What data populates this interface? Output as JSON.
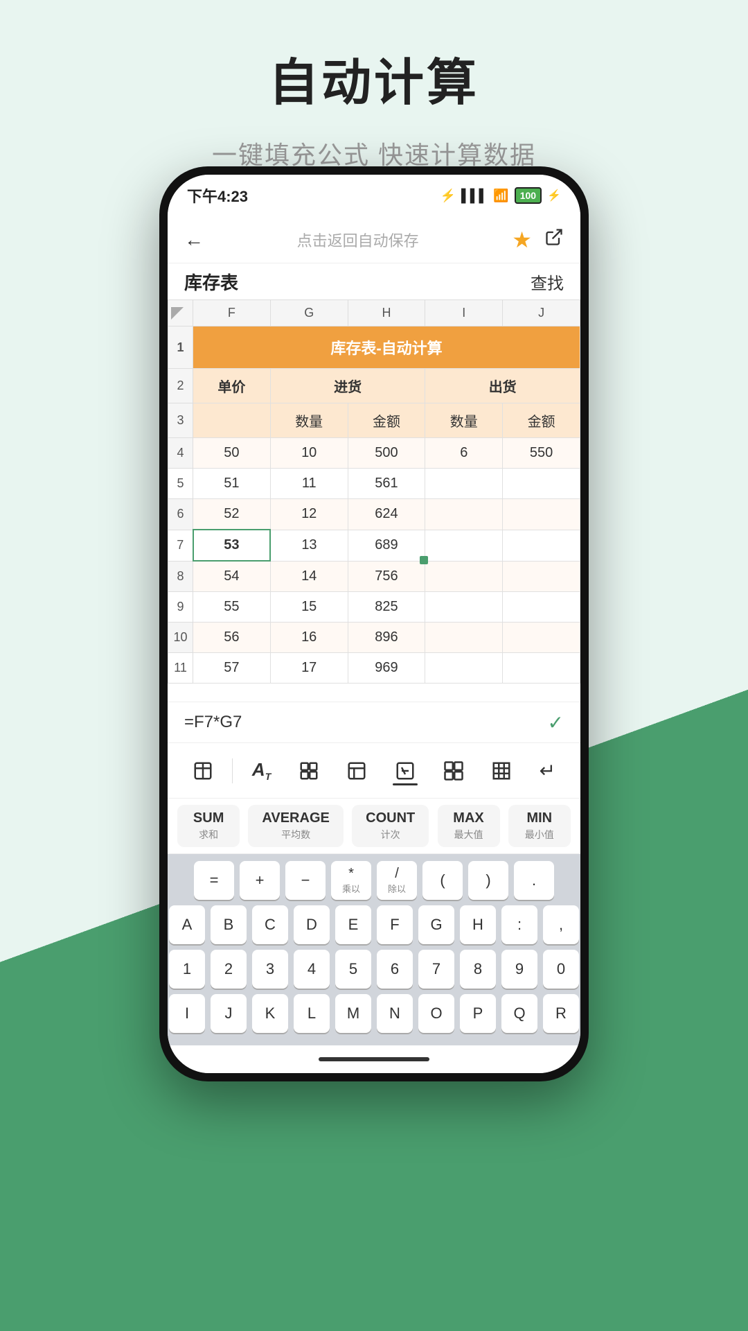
{
  "page": {
    "title": "自动计算",
    "subtitle": "一键填充公式 快速计算数据"
  },
  "status_bar": {
    "time": "下午4:23",
    "battery": "100"
  },
  "nav": {
    "back_label": "←",
    "center_label": "点击返回自动保存"
  },
  "sheet": {
    "name": "库存表",
    "find": "查找",
    "title": "库存表-自动计算",
    "col_headers": [
      "",
      "F",
      "G",
      "H",
      "I",
      "J"
    ],
    "row2": [
      "单价",
      "进货",
      "",
      "出货",
      ""
    ],
    "row3": [
      "",
      "数量",
      "金额",
      "数量",
      "金额"
    ],
    "rows": [
      {
        "num": "4",
        "f": "50",
        "g": "10",
        "h": "500",
        "i": "6",
        "j": "550"
      },
      {
        "num": "5",
        "f": "51",
        "g": "11",
        "h": "561",
        "i": "",
        "j": ""
      },
      {
        "num": "6",
        "f": "52",
        "g": "12",
        "h": "624",
        "i": "",
        "j": ""
      },
      {
        "num": "7",
        "f": "53",
        "g": "13",
        "h": "689",
        "i": "",
        "j": "",
        "selected": true
      },
      {
        "num": "8",
        "f": "54",
        "g": "14",
        "h": "756",
        "i": "",
        "j": ""
      },
      {
        "num": "9",
        "f": "55",
        "g": "15",
        "h": "825",
        "i": "",
        "j": ""
      },
      {
        "num": "10",
        "f": "56",
        "g": "16",
        "h": "896",
        "i": "",
        "j": ""
      },
      {
        "num": "11",
        "f": "57",
        "g": "17",
        "h": "969",
        "i": "",
        "j": ""
      }
    ]
  },
  "formula_bar": {
    "formula": "=F7*G7"
  },
  "toolbar": {
    "items": [
      {
        "icon": "⊟",
        "name": "table-settings"
      },
      {
        "icon": "A",
        "name": "text-format",
        "sub": "T"
      },
      {
        "icon": "⊞",
        "name": "cell-format"
      },
      {
        "icon": "⬚",
        "name": "freeze"
      },
      {
        "icon": "✕",
        "name": "formula",
        "active": true
      },
      {
        "icon": "⊞⊞",
        "name": "merge"
      },
      {
        "icon": "⊟",
        "name": "border"
      },
      {
        "icon": "↵",
        "name": "newline"
      }
    ]
  },
  "functions": [
    {
      "main": "SUM",
      "sub": "求和"
    },
    {
      "main": "AVERAGE",
      "sub": "平均数"
    },
    {
      "main": "COUNT",
      "sub": "计次"
    },
    {
      "main": "MAX",
      "sub": "最大值"
    },
    {
      "main": "MIN",
      "sub": "最小值"
    }
  ],
  "keyboard": {
    "row_ops": [
      "=",
      "+",
      "-",
      "×\n乘以",
      "÷\n除以",
      "(",
      ")",
      "."
    ],
    "row_alpha1": [
      "A",
      "B",
      "C",
      "D",
      "E",
      "F",
      "G",
      "H",
      ":",
      ","
    ],
    "row_num": [
      "1",
      "2",
      "3",
      "4",
      "5",
      "6",
      "7",
      "8",
      "9",
      "0"
    ],
    "row_alpha2": [
      "I",
      "J",
      "K",
      "L",
      "M",
      "N",
      "O",
      "P",
      "Q",
      "R"
    ]
  }
}
